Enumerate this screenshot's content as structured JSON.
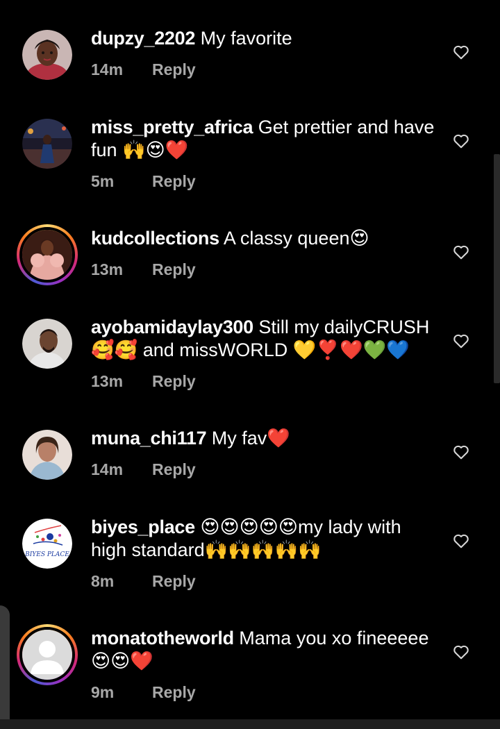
{
  "comments": [
    {
      "username": "dupzy_2202",
      "text": " My favorite",
      "time": "14m",
      "reply": "Reply"
    },
    {
      "username": "miss_pretty_africa",
      "text": " Get prettier and have fun 🙌😍❤️",
      "time": "5m",
      "reply": "Reply"
    },
    {
      "username": "kudcollections",
      "text": " A classy queen😍",
      "time": "13m",
      "reply": "Reply"
    },
    {
      "username": "ayobamidaylay300",
      "text": " Still my dailyCRUSH 🥰🥰 and missWORLD 💛❣️❤️💚💙",
      "time": "13m",
      "reply": "Reply"
    },
    {
      "username": "muna_chi117",
      "text": " My fav❤️",
      "time": "14m",
      "reply": "Reply"
    },
    {
      "username": "biyes_place",
      "text": " 😍😍😍😍😍my lady with high standard🙌🙌🙌🙌🙌",
      "time": "8m",
      "reply": "Reply"
    },
    {
      "username": "monatotheworld",
      "text": " Mama you xo fineeeee 😍😍❤️",
      "time": "9m",
      "reply": "Reply"
    }
  ],
  "avatar_logo_text": "BIYES PLACE",
  "colors": {
    "background": "#000000",
    "text": "#ffffff",
    "meta": "#a8a8a8",
    "story_ring": [
      "#feda75",
      "#fa7e1e",
      "#d62976",
      "#962fbf",
      "#4f5bd5"
    ]
  },
  "icons": {
    "like": "heart-outline-icon"
  }
}
